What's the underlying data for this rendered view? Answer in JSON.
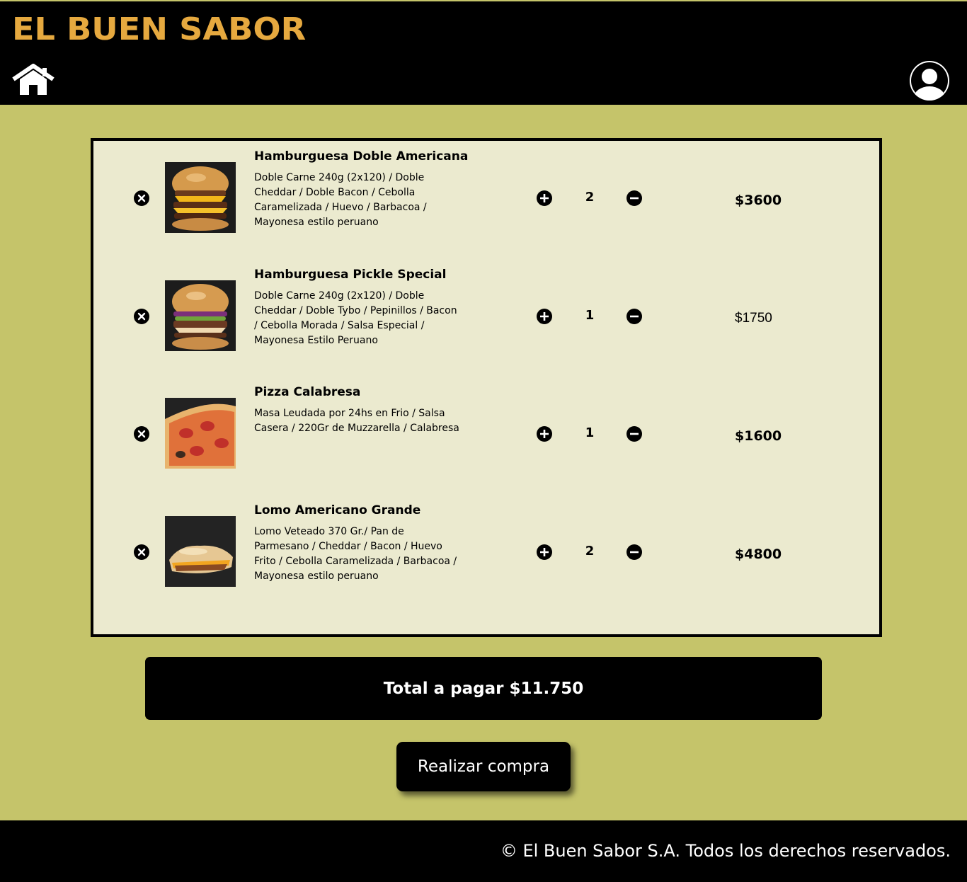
{
  "header": {
    "brand": "EL BUEN SABOR",
    "home_icon": "home-icon",
    "user_icon": "user-account-icon"
  },
  "cart": {
    "items": [
      {
        "title": "Hamburguesa Doble Americana",
        "description": "Doble Carne 240g (2x120) / Doble Cheddar / Doble Bacon / Cebolla Caramelizada / Huevo / Barbacoa / Mayonesa estilo peruano",
        "quantity": "2",
        "price": "$3600",
        "image": "burger-photo"
      },
      {
        "title": "Hamburguesa Pickle Special",
        "description": "Doble Carne 240g (2x120) / Doble Cheddar / Doble Tybo / Pepinillos / Bacon / Cebolla Morada / Salsa Especial / Mayonesa Estilo Peruano",
        "quantity": "1",
        "price": "$1750",
        "image": "burger-photo"
      },
      {
        "title": "Pizza Calabresa",
        "description": "Masa Leudada por 24hs en Frio / Salsa Casera / 220Gr de Muzzarella / Calabresa",
        "quantity": "1",
        "price": "$1600",
        "image": "pizza-photo"
      },
      {
        "title": "Lomo Americano Grande",
        "description": "Lomo Veteado 370 Gr./ Pan de Parmesano / Cheddar / Bacon / Huevo Frito / Cebolla Caramelizada / Barbacoa / Mayonesa estilo peruano",
        "quantity": "2",
        "price": "$4800",
        "image": "sandwich-photo"
      }
    ]
  },
  "summary": {
    "total_label": "Total a pagar $11.750",
    "buy_label": "Realizar compra"
  },
  "footer": {
    "copyright": "© El Buen Sabor S.A. Todos los derechos reservados."
  },
  "colors": {
    "background": "#c5c46a",
    "brand": "#e6a93f",
    "panel": "#ebeacf",
    "bars": "#000000"
  }
}
